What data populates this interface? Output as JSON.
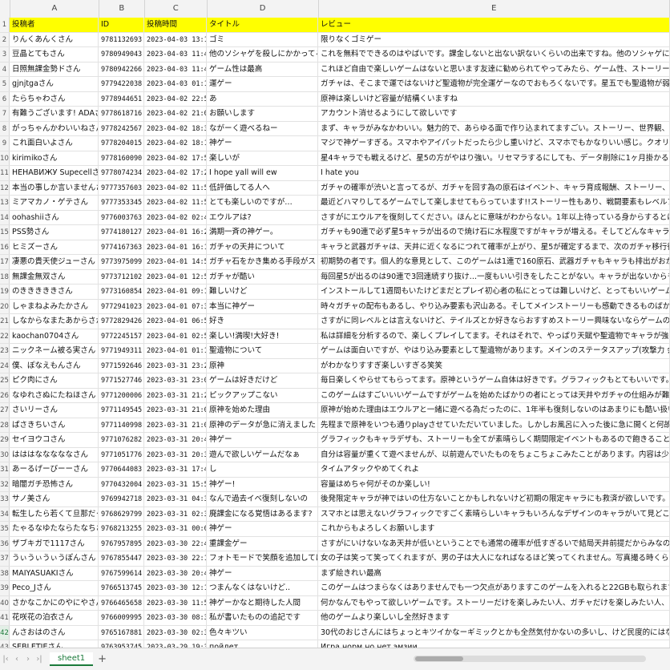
{
  "columns": [
    "A",
    "B",
    "C",
    "D",
    "E"
  ],
  "header": [
    "投稿者",
    "ID",
    "投稿時間",
    "タイトル",
    "レビュー"
  ],
  "rows": [
    [
      "りんくあんくさん",
      "9781132693",
      "2023-04-03 13:16",
      "ゴミ",
      "限りなくゴミゲー"
    ],
    [
      "豆晶とてもさん",
      "9780949043",
      "2023-04-03 11:47",
      "他のソシャゲを殺しにかかってるゲーム",
      "これを無料でできるのはやばいです。課金しないと出ない訳ないくらいの出来ですね。他のソシャゲに全と時間使うのがお休みないと思うと"
    ],
    [
      "日照無課金勢ドさん",
      "9780942266",
      "2023-04-03 11:44",
      "ゲーム性は最高",
      "これほど自由で楽しいゲームはないと思います友達に勧められてやってみたら、ゲーム性、ストーリー、キャラデザなど、素晴らしい要素が"
    ],
    [
      "gjnjtgaさん",
      "9779422038",
      "2023-04-03 01:17",
      "運ゲー",
      "ガチャは、そこまで運ではないけど聖遺物が完全運ゲーなのでおもろくないです。星五でも聖遺物が弱いとキャラなどもいますが、聖遺物"
    ],
    [
      "たらちゃわさん",
      "9778944651",
      "2023-04-02 22:50",
      "あ",
      "原神は楽しいけど容量が結構くいますね"
    ],
    [
      "有難うございます! ADAさん",
      "9778618716",
      "2023-04-02 21:03",
      "お願いします",
      "アカウント消せるようにして欲しいです"
    ],
    [
      "がっちゃんかわいいねさん",
      "9778242567",
      "2023-04-02 18:32",
      "ながーく遊べるねー",
      "まず、キャラがみなかわいい。魅力的で、あらゆる面で作り込まれてますごい。ストーリー、世界観、キャラ一人ずつそれぞれの設定に制作の"
    ],
    [
      "これ面白いよさん",
      "9778204015",
      "2023-04-02 18:16",
      "神ゲー",
      "マジで神ゲーすぎる。スマホやアイパットだったら少し重いけど、スマホでもかなりいい感じ。クオリティの高いこのゲームが無料"
    ],
    [
      "kirimikoさん",
      "9778160090",
      "2023-04-02 17:57",
      "楽しいが",
      "星4キャラでも戦えるけど、星5の方がやはり強い。リセマラするにしても、データ削除に1ヶ月掛かるから、リセマラが長いのが難点。楽"
    ],
    [
      "НЕНАВИЖУ Supecellさん",
      "9778074234",
      "2023-04-02 17:20",
      "I hope yall will ew",
      "I hate you"
    ],
    [
      "本当の事しか言いませんさん",
      "9777357603",
      "2023-04-02 11:58",
      "低評価してる人へ",
      "ガチャの確率が渋いと言ってるが、ガチャを回す為の原石はイベント、キャラ育成報酬、ストーリー、マップ上のギミック.... 欲しい"
    ],
    [
      "ミアマカノ・ゲテさん",
      "9777353345",
      "2023-04-02 11:56",
      "とても楽しいのですが…",
      "最近どハマりしてるゲームでして楽しませてもらっています!!ストーリー性もあり、戦闘要素もレベルアップ要素もあって本当に楽しい"
    ],
    [
      "oohashiiさん",
      "9776003763",
      "2023-04-02 02:45",
      "エウルアは?",
      "さすがにエウルアを復刻してください。ほんとに意味がわからない。1年以上待っている身からするとほんとに辛いです"
    ],
    [
      "PSS勢さん",
      "9774180127",
      "2023-04-01 16:24",
      "満期一斉の神ゲー。",
      "ガチャも90連で必ず星5キャラが出るので焼け石に水程度ですがキャラが増える。そしてどんなキャラでも頑張って"
    ],
    [
      "ヒミズーさん",
      "9774167363",
      "2023-04-01 16:19",
      "ガチャの天井について",
      "キャラと武器ガチャは、天井に近くなるにつれて確率が上がり、星5が確定するまで、次のガチャ移行後も天井はリセットされません。"
    ],
    [
      "凄悪の貴天使ジューさん",
      "9773975099",
      "2023-04-01 14:52",
      "ガチャ石をかき集める手段がストーリー達",
      "初期勢の者です。個人的な意見として、このゲームは1連で160原石、武器ガチャもキャラも排出がおかしいとキャラが強く、武器集"
    ],
    [
      "無課金無双さん",
      "9773712102",
      "2023-04-01 12:52",
      "ガチャが酷い",
      "毎回星5が出るのは90連で3回連続すり抜け…一度もいい引きをしたことがない。キャラが出ないからモチベが上がらない"
    ],
    [
      "のきききききさん",
      "9773160854",
      "2023-04-01 09:12",
      "難しいけど",
      "インストールして1週間もいたけどまだとプレイ初心者の私にとっては難しいけど、とってもいいゲームです。マルチプレ"
    ],
    [
      "しゃまねよみたかさん",
      "9772941023",
      "2023-04-01 07:39",
      "本当に神ゲー",
      "時々ガチャの配布もあるし、やり込み要素も沢山ある。そしてメインストーリーも感動できるものばかりで最高の神ゲーだ!!"
    ],
    [
      "しなからなまたあからさかたまさ",
      "9772829426",
      "2023-04-01 06:52",
      "好き",
      "さすがに同レベルとは言えないけど、テイルズとか好きならおすすめストーリー興味ないならゲームの一気にいい時間と容量の無駄botで良"
    ],
    [
      "kaochan0704さん",
      "9772245157",
      "2023-04-01 02:57",
      "楽しい!満喫!大好き!",
      "私は詳細を分析するので、楽しくプレイしてます。それはそれで、やっぱり天賦や聖遺物でキャラが強くなると嬉しくて、もっと高みを目指"
    ],
    [
      "ニックネーム被る実さん",
      "9771949311",
      "2023-04-01 01:15",
      "聖遺物について",
      "ゲームは面白いですが、やはり込み要素として聖遺物があります。メインのステータスアップ(攻撃力 会心率など)とサブで4つのステータス"
    ],
    [
      "僕、ぽなえもんさん",
      "9771592646",
      "2023-03-31 23:27",
      "原神",
      "がわかなりすすぎ楽しいすぎる笑笑"
    ],
    [
      "ピク肉にさん",
      "9771527746",
      "2023-03-31 23:08",
      "ゲームは好きだけど",
      "毎日楽しくやらせてもらってます。原神というゲーム自体は好きです。グラフィックもとてもいいです。ストーリーもかなり作り込まれて"
    ],
    [
      "なゆれさぬにたねほさん",
      "9771200006",
      "2023-03-31 21:26",
      "ピックアップこない",
      "このゲームはすごいいいゲームですがゲームを始めたばかりの者にとっては天井やガチャの仕組みが難しくて苦しいです"
    ],
    [
      "さいリーさん",
      "9771149545",
      "2023-03-31 21:09",
      "原神を始めた理由",
      "原神が始めた理由はエウルアと一緒に遊べる為だったのに、1年半も復刻しないのはあまりにも酷い扱いすぎると思い今回はレビューを書"
    ],
    [
      "ぱさきちいさん",
      "9771140998",
      "2023-03-31 21:06",
      "原神のデータが急に消えました",
      "先程まで原神をいつも通りplayさせていただいていました。しかしお風呂に入った後に急に開くと何故か最初の初めてアプリを開いた"
    ],
    [
      "セイヨウコさん",
      "9771076282",
      "2023-03-31 20:49",
      "神ゲー",
      "グラフィックもキャラデザも、ストーリーも全てが素晴らしく期間限定イベントもあるので飽きることがありません。ガチャにはしっかり天"
    ],
    [
      "はははなななななさん",
      "9771051776",
      "2023-03-31 20:35",
      "遊んで欲しいゲームだなぁ",
      "自分は容量が重くて遊べませんが、以前遊んでいたものをちょこちょこみたことがあります。内容は少々過剰ですが、とても楽しいゲーム"
    ],
    [
      "あーるげーびーーさん",
      "9770644083",
      "2023-03-31 17:44",
      "し",
      "タイムアタックやめてくれよ"
    ],
    [
      "暗闇ガチ恐怖さん",
      "9770432004",
      "2023-03-31 15:58",
      "神ゲー!",
      "容量はめちゃ何がそのか楽しい!"
    ],
    [
      "サノ美さん",
      "9769942718",
      "2023-03-31 04:35",
      "なんで過去イベ復刻しないの",
      "後発限定キャラが神ではいの仕方ないことかもしれないけど初期の限定キャラにも救済が欲しいです。プレイしてる層は比較的歩いているので"
    ],
    [
      "転生したら若くて旦那だった件さん",
      "9768629799",
      "2023-03-31 02:32",
      "廃課金になる覚悟はあるます?",
      "スマホとは思えないグラフィックですごく素晴らしいキャラもいろんなデザインのキャラがいて見どころがあるが、いわゆるガチャ"
    ],
    [
      "たゃるなゆたならたなちさん",
      "9768213255",
      "2023-03-31 00:08",
      "神ゲー",
      "これからもよろしくお願いします"
    ],
    [
      "ザブキガで1117さん",
      "9767957895",
      "2023-03-30 22:47",
      "重課金ゲー",
      "さすがにいけないなあ天井が低いということでも通常の確率が低すぎるいで結局天井前提だからみなの諦めがあるしかもガチャ回す時に"
    ],
    [
      "うぃうぃうぃうぽんさん",
      "9767855447",
      "2023-03-30 22:14",
      "フォトモードで笑顔を追加してほしい",
      "女の子は笑って笑ってくれますが、男の子は大人になればなるほど笑ってくれません。写真撮る時くらい笑顔があるといいのですが"
    ],
    [
      "MAIYASUAKIさん",
      "9767599614",
      "2023-03-30 20:48",
      "神ゲー",
      "まず絵きれい最高"
    ],
    [
      "Peco_Jさん",
      "9766513745",
      "2023-03-30 12:12",
      "つまんなくはないけど..",
      "このゲームはつまらなくはありませんでも一つ欠点がありますこのゲームを入れると22GBも取られます!!"
    ],
    [
      "さかなこかにのやにやさん",
      "9766465658",
      "2023-03-30 11:50",
      "神ゲーかなと期待した人間",
      "何かなんでもやって欲しいゲームです。ストーリーだけを楽しみたい人、ガチャだけを楽しみたい人、その他何でもやって!!元素"
    ],
    [
      "花咲花の泊衣さん",
      "9766009995",
      "2023-03-30 08:31",
      "私が書いたものの追記です",
      "他のゲームより楽しいし全然好きます"
    ],
    [
      "んさおはのさん",
      "9765167881",
      "2023-03-30 02:34",
      "色々キツい",
      "30代のおじさんにはちょっとキツイかなーギミックとかも全然気付かないの多いし、けど民度的にはなんか出来て当たり前みたいに思って"
    ],
    [
      "SEBLETIEさん",
      "9763953745",
      "2023-03-29 19:36",
      "пойдет",
      "Игра норм но нет эмзии"
    ],
    [
      "いちのみやかけにさん",
      "9763821568",
      "2023-03-29 18:36",
      "おもしろいけど…",
      "ゲームの内容ではかなり面白い。グラフィックやボイスなども凝っていて、申し分ない。ただ、攻撃ボタンやジャンプボタンなどの"
    ]
  ],
  "selected_row": 42,
  "footer": {
    "sheet_tab": "sheet1",
    "add_tab": "+"
  }
}
